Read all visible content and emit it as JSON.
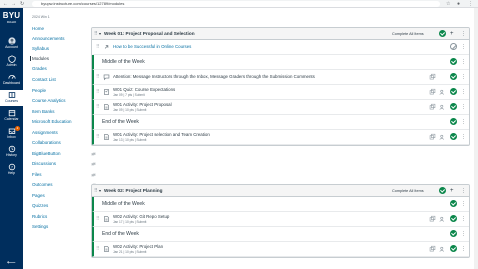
{
  "browser": {
    "url": "byupw.instructure.com/courses/12789/modules"
  },
  "global_nav": {
    "logo": {
      "big": "BYU",
      "small": "IDAHO"
    },
    "items": [
      {
        "label": "Account",
        "icon": "account-icon"
      },
      {
        "label": "Admin",
        "icon": "admin-icon"
      },
      {
        "label": "Dashboard",
        "icon": "dashboard-icon"
      },
      {
        "label": "Courses",
        "icon": "courses-icon"
      },
      {
        "label": "Calendar",
        "icon": "calendar-icon"
      },
      {
        "label": "Inbox",
        "icon": "inbox-icon",
        "badge": "2"
      },
      {
        "label": "History",
        "icon": "history-icon"
      },
      {
        "label": "Help",
        "icon": "help-icon"
      }
    ],
    "collapse_glyph": "⟵"
  },
  "course_nav": {
    "term": "2024 Win 1",
    "links": [
      {
        "label": "Home"
      },
      {
        "label": "Announcements"
      },
      {
        "label": "Syllabus"
      },
      {
        "label": "Modules",
        "active": true
      },
      {
        "label": "Grades"
      },
      {
        "label": "Contact List"
      },
      {
        "label": "People"
      },
      {
        "label": "Course Analytics"
      },
      {
        "label": "Item Banks"
      },
      {
        "label": "Microsoft Education"
      },
      {
        "label": "Assignments",
        "hidden": true
      },
      {
        "label": "Collaborations",
        "hidden": true
      },
      {
        "label": "BigBlueButton",
        "hidden": true
      },
      {
        "label": "Discussions",
        "hidden": true
      },
      {
        "label": "Files",
        "hidden": true
      },
      {
        "label": "Outcomes",
        "hidden": true
      },
      {
        "label": "Pages",
        "hidden": true
      },
      {
        "label": "Quizzes",
        "hidden": true
      },
      {
        "label": "Rubrics",
        "hidden": true
      },
      {
        "label": "Settings"
      }
    ]
  },
  "modules": [
    {
      "title": "Week 01: Project Proposal and Selection",
      "complete_label": "Complete All Items",
      "items": [
        {
          "kind": "link",
          "title": "How to be Successful in Online Courses",
          "published": false
        },
        {
          "kind": "header",
          "title": "Middle of the Week",
          "published": true
        },
        {
          "kind": "discussion",
          "title": "Attention: Message Instructors through the Inbox, Message Graders through the Submission Comments",
          "published": true
        },
        {
          "kind": "quiz",
          "title": "W01 Quiz: Course Expectations",
          "meta": "Jan 09 | 7 pts | Submit",
          "published": true
        },
        {
          "kind": "assignment",
          "title": "W01 Activity: Project Proposal",
          "meta": "Jan 09 | 10 pts | Submit",
          "published": true
        },
        {
          "kind": "header",
          "title": "End of the Week",
          "published": true
        },
        {
          "kind": "assignment",
          "title": "W01 Activity: Project selection and Team Creation",
          "meta": "Jan 13 | 10 pts | Submit",
          "published": true
        }
      ]
    },
    {
      "title": "Week 02: Project Planning",
      "complete_label": "Complete All Items",
      "items": [
        {
          "kind": "header",
          "title": "Middle of the Week",
          "published": true
        },
        {
          "kind": "assignment",
          "title": "W02 Activity: Git Repo Setup",
          "meta": "Jan 17 | 10 pts | Submit",
          "published": true
        },
        {
          "kind": "header",
          "title": "End of the Week",
          "published": true
        },
        {
          "kind": "assignment",
          "title": "W02 Activity: Project Plan",
          "meta": "Jan 21 | 10 pts | Submit",
          "published": true
        }
      ]
    }
  ],
  "colors": {
    "global_nav_bg": "#002e5d",
    "link": "#0770a3",
    "published_green": "#0b874b",
    "badge_orange": "#e66000"
  }
}
